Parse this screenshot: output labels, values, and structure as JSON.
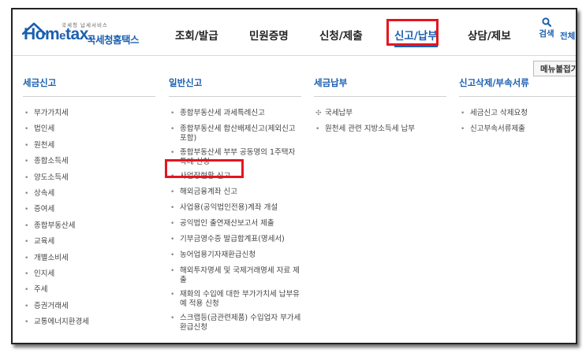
{
  "brand": {
    "tagline": "국세청 납세서비스",
    "wordmark_prefix": "Hom",
    "wordmark_e": "e",
    "wordmark_suffix": "tax.",
    "korean_name": "국세청홈택스",
    "color": "#1b5fb0"
  },
  "nav": {
    "items": [
      "조회/발급",
      "민원증명",
      "신청/제출",
      "신고/납부",
      "상담/제보"
    ],
    "active": "신고/납부",
    "search_label": "검색",
    "all_label": "전체"
  },
  "panel": {
    "close_label": "메뉴불접기",
    "columns": [
      {
        "title": "세금신고",
        "items": [
          "부가가치세",
          "법인세",
          "원천세",
          "종합소득세",
          "양도소득세",
          "상속세",
          "증여세",
          "종합부동산세",
          "교육세",
          "개별소비세",
          "인지세",
          "주세",
          "증권거래세",
          "교통에너지환경세"
        ]
      },
      {
        "title": "일반신고",
        "items": [
          "종합부동산세 과세특례신고",
          "종합부동산세 합산배제신고(제외신고 포함)",
          "종합부동산세 부부 공동명의 1주택자 특례 신청",
          "사업장현황 신고",
          "해외금융계좌 신고",
          "사업용(공익법인전용)계좌 개설",
          "공익법인 출연재산보고서 제출",
          "기부금영수증 발급합계표(명세서)",
          "농어업용기자재환급신청",
          "해외투자명세 및 국제거래명세 자료 제출",
          "재화의 수입에 대한 부가가치세 납부유예 적용 신청",
          "스크랩등(금관련제품) 수입업자 부가세 환급신청"
        ]
      },
      {
        "title": "세금납부",
        "items": [
          "국세납부",
          "원천세 관련 지방소득세 납부"
        ]
      },
      {
        "title": "신고삭제/부속서류",
        "items": [
          "세금신고 삭제요청",
          "신고부속서류제출"
        ]
      }
    ]
  },
  "highlight_color": "#e5151f"
}
